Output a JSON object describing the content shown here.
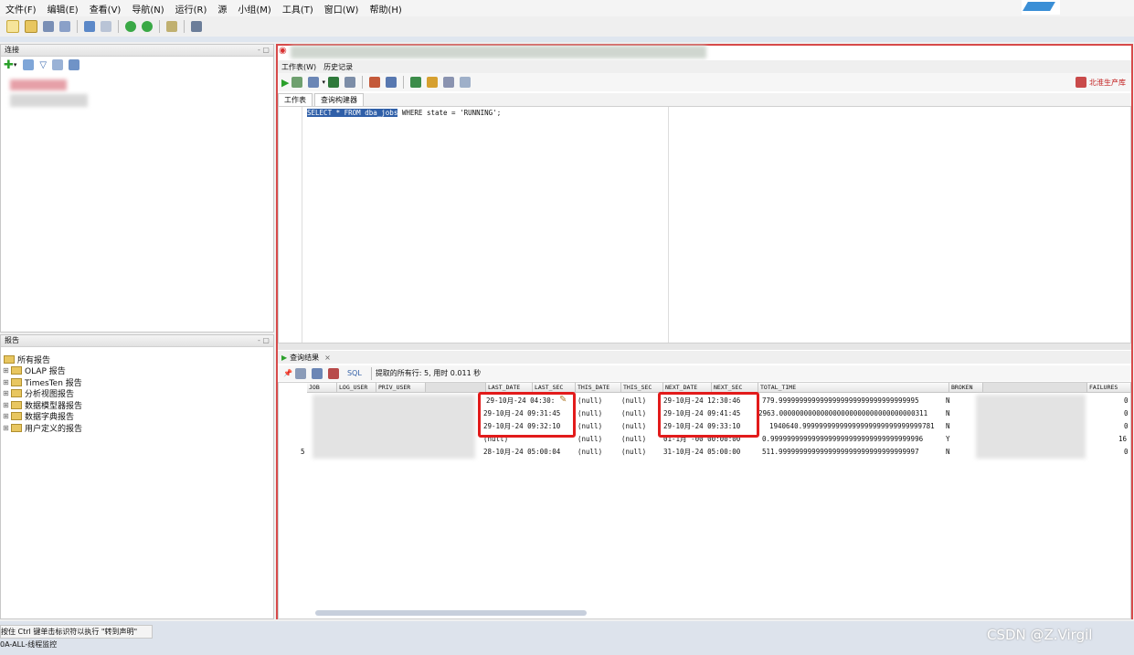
{
  "menu": [
    "文件(F)",
    "编辑(E)",
    "查看(V)",
    "导航(N)",
    "运行(R)",
    "源",
    "小组(M)",
    "工具(T)",
    "窗口(W)",
    "帮助(H)"
  ],
  "connections_panel": {
    "title": "连接"
  },
  "reports_panel": {
    "title": "报告",
    "items": [
      "所有报告",
      "OLAP 报告",
      "TimesTen 报告",
      "分析视图报告",
      "数据模型器报告",
      "数据字典报告",
      "用户定义的报告"
    ]
  },
  "editor": {
    "tabs": [
      "工作表(W)",
      "历史记录"
    ],
    "subtabs": [
      "工作表",
      "查询构建器"
    ],
    "connection_label": "北淮生产库",
    "sql_highlight": "SELECT * FROM dba_jobs",
    "sql_rest": " WHERE state = 'RUNNING';"
  },
  "results": {
    "tab_label": "查询结果",
    "status": "提取的所有行: 5, 用时 0.011 秒",
    "sql_label": "SQL",
    "columns": [
      "JOB",
      "LOG_USER",
      "PRIV_USER",
      "LAST_DATE",
      "LAST_SEC",
      "THIS_DATE",
      "THIS_SEC",
      "NEXT_DATE",
      "NEXT_SEC",
      "TOTAL_TIME",
      "BROKEN",
      "FAILURES"
    ],
    "rows": [
      {
        "job": "",
        "last": "29-10月-24 04:30:",
        "this_date": "(null)",
        "this_sec": "(null)",
        "next": "29-10月-24 12:30:46",
        "total": "779.9999999999999999999999999999999995",
        "broken": "N",
        "failures": "0"
      },
      {
        "job": "",
        "last": "29-10月-24 09:31:45",
        "this_date": "(null)",
        "this_sec": "(null)",
        "next": "29-10月-24 09:41:45",
        "total": "2963.000000000000000000000000000000000311",
        "broken": "N",
        "failures": "0"
      },
      {
        "job": "",
        "last": "29-10月-24 09:32:10",
        "this_date": "(null)",
        "this_sec": "(null)",
        "next": "29-10月-24 09:33:10",
        "total": "1940640.99999999999999999999999999999781",
        "broken": "N",
        "failures": "0"
      },
      {
        "job": "",
        "last": "(null)",
        "this_date": "(null)",
        "this_sec": "(null)",
        "next": "01-1月 -00 00:00:00",
        "total": "0.9999999999999999999999999999999999996",
        "broken": "Y",
        "failures": "16"
      },
      {
        "job": "5",
        "last": "28-10月-24 05:00:04",
        "this_date": "(null)",
        "this_sec": "(null)",
        "next": "31-10月-24 05:00:00",
        "total": "511.9999999999999999999999999999999997",
        "broken": "N",
        "failures": "0"
      }
    ]
  },
  "status_bar": {
    "hint": "按住 Ctrl 键单击标识符以执行 \"转到声明\"",
    "sub": "0A-ALL-线程监控"
  },
  "watermark": "CSDN @Z.Virgil",
  "colors": {
    "highlight": "#e21b1b",
    "selection": "#2f5fa8"
  }
}
